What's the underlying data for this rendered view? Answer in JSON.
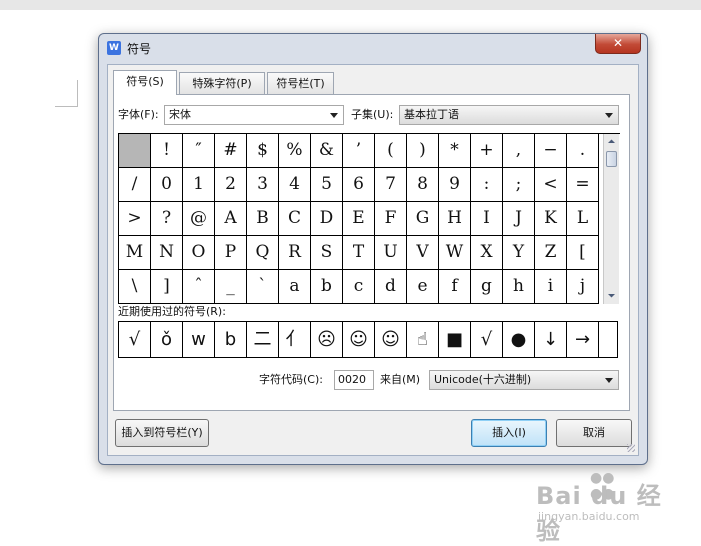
{
  "dialog": {
    "title": "符号",
    "app_icon_letter": "W",
    "close_glyph": "✕"
  },
  "tabs": [
    {
      "label": "符号(S)",
      "active": true
    },
    {
      "label": "特殊字符(P)",
      "active": false
    },
    {
      "label": "符号栏(T)",
      "active": false
    }
  ],
  "font": {
    "label": "字体(F):",
    "value": "宋体"
  },
  "subset": {
    "label": "子集(U):",
    "value": "基本拉丁语"
  },
  "symbol_grid": {
    "selected_index": 0,
    "rows": [
      [
        " ",
        "!",
        "″",
        "#",
        "$",
        "%",
        "&",
        "’",
        "(",
        ")",
        "*",
        "+",
        ",",
        "−",
        "."
      ],
      [
        "/",
        "0",
        "1",
        "2",
        "3",
        "4",
        "5",
        "6",
        "7",
        "8",
        "9",
        ":",
        ";",
        "<",
        "="
      ],
      [
        ">",
        "?",
        "@",
        "A",
        "B",
        "C",
        "D",
        "E",
        "F",
        "G",
        "H",
        "I",
        "J",
        "K",
        "L"
      ],
      [
        "M",
        "N",
        "O",
        "P",
        "Q",
        "R",
        "S",
        "T",
        "U",
        "V",
        "W",
        "X",
        "Y",
        "Z",
        "["
      ],
      [
        "\\",
        "]",
        "ˆ",
        "_",
        "`",
        "a",
        "b",
        "c",
        "d",
        "e",
        "f",
        "g",
        "h",
        "i",
        "j"
      ]
    ]
  },
  "recent": {
    "label": "近期使用过的符号(R):",
    "symbols": [
      "√",
      "ǒ",
      "w",
      "b",
      "二",
      "亻",
      "☹",
      "☺",
      "☺",
      "☝",
      "■",
      "√",
      "●",
      "↓",
      "→"
    ]
  },
  "char_code": {
    "label": "字符代码(C):",
    "value": "0020"
  },
  "from": {
    "label": "来自(M)",
    "value": "Unicode(十六进制)"
  },
  "buttons": {
    "insert_to_bar": "插入到符号栏(Y)",
    "insert": "插入(I)",
    "cancel": "取消"
  },
  "watermark": {
    "logo": "Bai du 经验",
    "url": "jingyan.baidu.com"
  },
  "colors": {
    "close_red": "#c24a36",
    "selected_cell": "#b6b6b6",
    "default_button": "#bfe2f8"
  }
}
